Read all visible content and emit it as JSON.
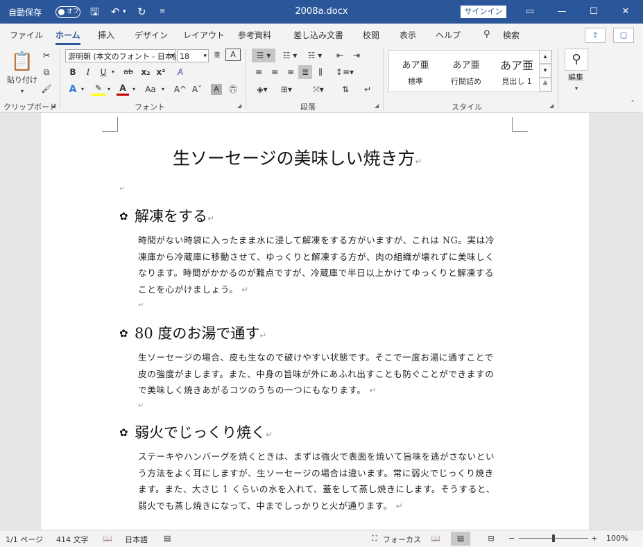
{
  "titlebar": {
    "autosave_label": "自動保存",
    "autosave_state": "オフ",
    "doc_title": "2008a.docx",
    "signin": "サインイン",
    "icons": [
      "save-icon",
      "undo-icon",
      "redo-icon",
      "customize-qat-icon",
      "ribbon-display-icon",
      "minimize-icon",
      "maximize-icon",
      "close-icon"
    ]
  },
  "tabs": [
    "ファイル",
    "ホーム",
    "挿入",
    "デザイン",
    "レイアウト",
    "参考資料",
    "差し込み文書",
    "校閲",
    "表示",
    "ヘルプ"
  ],
  "active_tab": "ホーム",
  "search_label": "検索",
  "ribbon": {
    "clipboard": {
      "label": "クリップボード",
      "paste": "貼り付け"
    },
    "font": {
      "label": "フォント",
      "font_name": "游明朝 (本文のフォント - 日本語)",
      "font_size": "18",
      "buttons": [
        "B",
        "I",
        "U",
        "ab",
        "x₂",
        "x²",
        "A",
        "A",
        "Aa",
        "A^",
        "Aˇ",
        "A",
        "字"
      ]
    },
    "paragraph": {
      "label": "段落"
    },
    "styles": {
      "label": "スタイル",
      "items": [
        {
          "preview": "あア亜",
          "name": "標準"
        },
        {
          "preview": "あア亜",
          "name": "行間詰め"
        },
        {
          "preview": "あア亜",
          "name": "見出し 1"
        }
      ]
    },
    "editing": {
      "label": "編集"
    }
  },
  "document": {
    "title": "生ソーセージの美味しい焼き方",
    "sections": [
      {
        "heading": "解凍をする",
        "lines": [
          "時間がない時袋に入ったまま水に浸して解凍をする方がいますが、これは NG。実は冷",
          "凍庫から冷蔵庫に移動させて、ゆっくりと解凍する方が、肉の組織が壊れずに美味しく",
          "なります。時間がかかるのが難点ですが、冷蔵庫で半日以上かけてゆっくりと解凍する",
          "ことを心がけましょう。"
        ]
      },
      {
        "heading": "80 度のお湯で通す",
        "lines": [
          "生ソーセージの場合、皮も生なので破けやすい状態です。そこで一度お湯に通すことで",
          "皮の強度がまします。また、中身の旨味が外にあふれ出すことも防ぐことができますの",
          "で美味しく焼きあがるコツのうちの一つにもなります。"
        ]
      },
      {
        "heading": "弱火でじっくり焼く",
        "lines": [
          "ステーキやハンバーグを焼くときは、まずは強火で表面を焼いて旨味を逃がさないとい",
          "う方法をよく耳にしますが、生ソーセージの場合は違います。常に弱火でじっくり焼き",
          "ます。また、大さじ 1 くらいの水を入れて、蓋をして蒸し焼きにします。そうすると、",
          "弱火でも蒸し焼きになって、中までしっかりと火が通ります。"
        ]
      }
    ],
    "para_mark": "↵"
  },
  "status": {
    "page": "1/1 ページ",
    "words": "414 文字",
    "language": "日本語",
    "focus": "フォーカス",
    "zoom": "100%",
    "zoom_level": 0.5
  },
  "colors": {
    "titlebar": "#2b579a",
    "ribbon": "#f3f3f3",
    "canvas": "#e6e6e6",
    "font_color": "#c00000",
    "highlight": "#ffff00"
  }
}
